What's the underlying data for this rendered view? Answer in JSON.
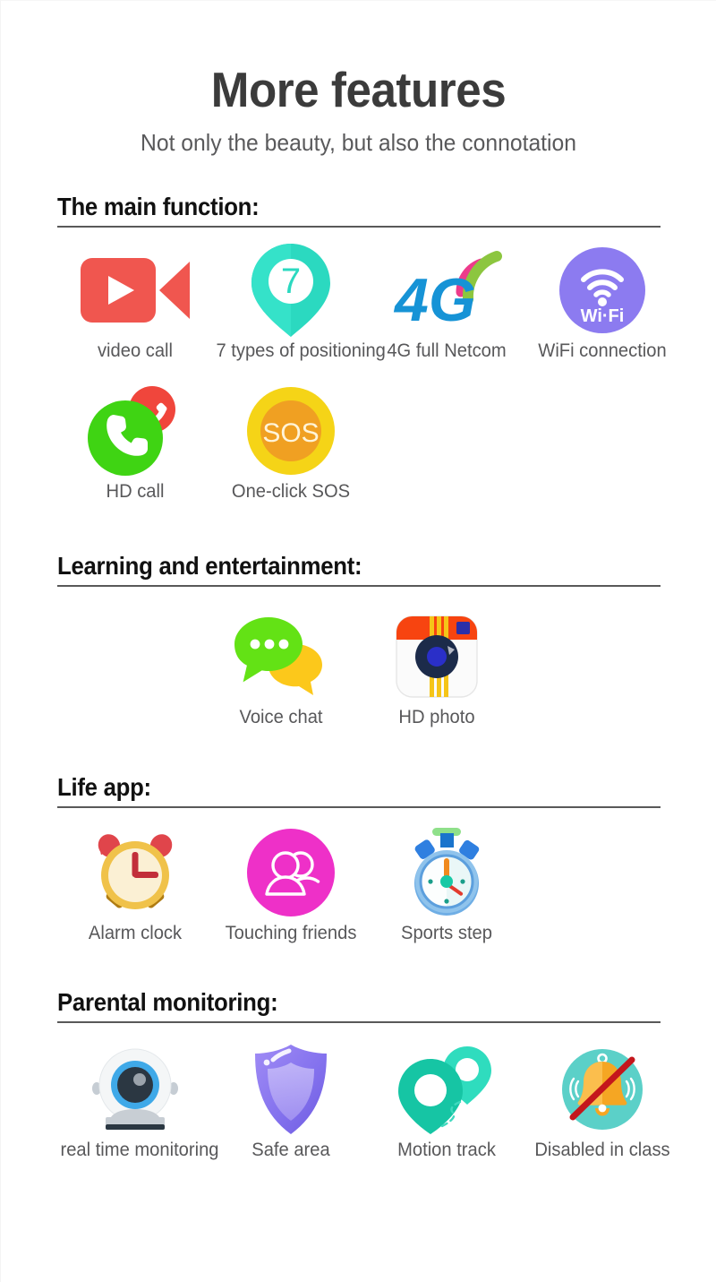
{
  "hero": {
    "title": "More features",
    "subtitle": "Not only the beauty, but also the connotation"
  },
  "sections": [
    {
      "heading": "The main function:",
      "rows": [
        [
          {
            "icon": "video-camera-icon",
            "label": "video call"
          },
          {
            "icon": "map-pin-seven-icon",
            "label": "7 types of positioning"
          },
          {
            "icon": "four-g-signal-icon",
            "label": "4G full Netcom"
          },
          {
            "icon": "wifi-circle-icon",
            "label": "WiFi connection"
          }
        ],
        [
          {
            "icon": "phone-call-icon",
            "label": "HD call"
          },
          {
            "icon": "sos-icon",
            "label": "One-click SOS"
          }
        ]
      ]
    },
    {
      "heading": "Learning and entertainment:",
      "rows": [
        [
          {
            "icon": "speech-bubble-icon",
            "label": "Voice chat"
          },
          {
            "icon": "camera-photo-icon",
            "label": "HD photo"
          }
        ]
      ]
    },
    {
      "heading": "Life app:",
      "rows": [
        [
          {
            "icon": "alarm-clock-icon",
            "label": "Alarm clock"
          },
          {
            "icon": "friends-icon",
            "label": "Touching friends"
          },
          {
            "icon": "stopwatch-icon",
            "label": "Sports step"
          }
        ]
      ]
    },
    {
      "heading": "Parental monitoring:",
      "rows": [
        [
          {
            "icon": "webcam-icon",
            "label": "real time monitoring"
          },
          {
            "icon": "shield-icon",
            "label": "Safe area"
          },
          {
            "icon": "motion-track-icon",
            "label": "Motion track"
          },
          {
            "icon": "bell-disabled-icon",
            "label": "Disabled in class"
          }
        ]
      ]
    }
  ],
  "icon_text": {
    "positioning_count": "7",
    "four_g": "4G",
    "wifi": "Wi·Fi",
    "sos": "SOS"
  },
  "colors": {
    "video_red": "#F0564F",
    "pin_teal": "#2BD9C0",
    "four_g_blue": "#1693D6",
    "four_g_pink": "#ED3B8B",
    "four_g_green": "#8CC63F",
    "wifi_purple": "#8C7BF0",
    "call_green": "#3FD413",
    "call_red": "#F0463C",
    "sos_yellow": "#F5D417",
    "sos_orange": "#F0A022",
    "chat_green": "#63E215",
    "chat_yellow": "#FCC81B",
    "photo_orange": "#F74410",
    "photo_yellow": "#F5C518",
    "photo_navy": "#1C2B4A",
    "clock_gold": "#F0C24A",
    "clock_cream": "#FBF0D4",
    "clock_red": "#E0454B",
    "friends_magenta": "#EE30C8",
    "stopwatch_blue": "#4A9BE0",
    "webcam_blue": "#3FA9E8",
    "shield_purple": "#7B6BE8",
    "track_teal": "#19C8A8",
    "bell_circle_teal": "#5BD0C8",
    "bell_orange": "#F5A623",
    "slash_red": "#C4161C",
    "heading_black": "#111111",
    "label_gray": "#58585A",
    "rule_gray": "#595959"
  }
}
